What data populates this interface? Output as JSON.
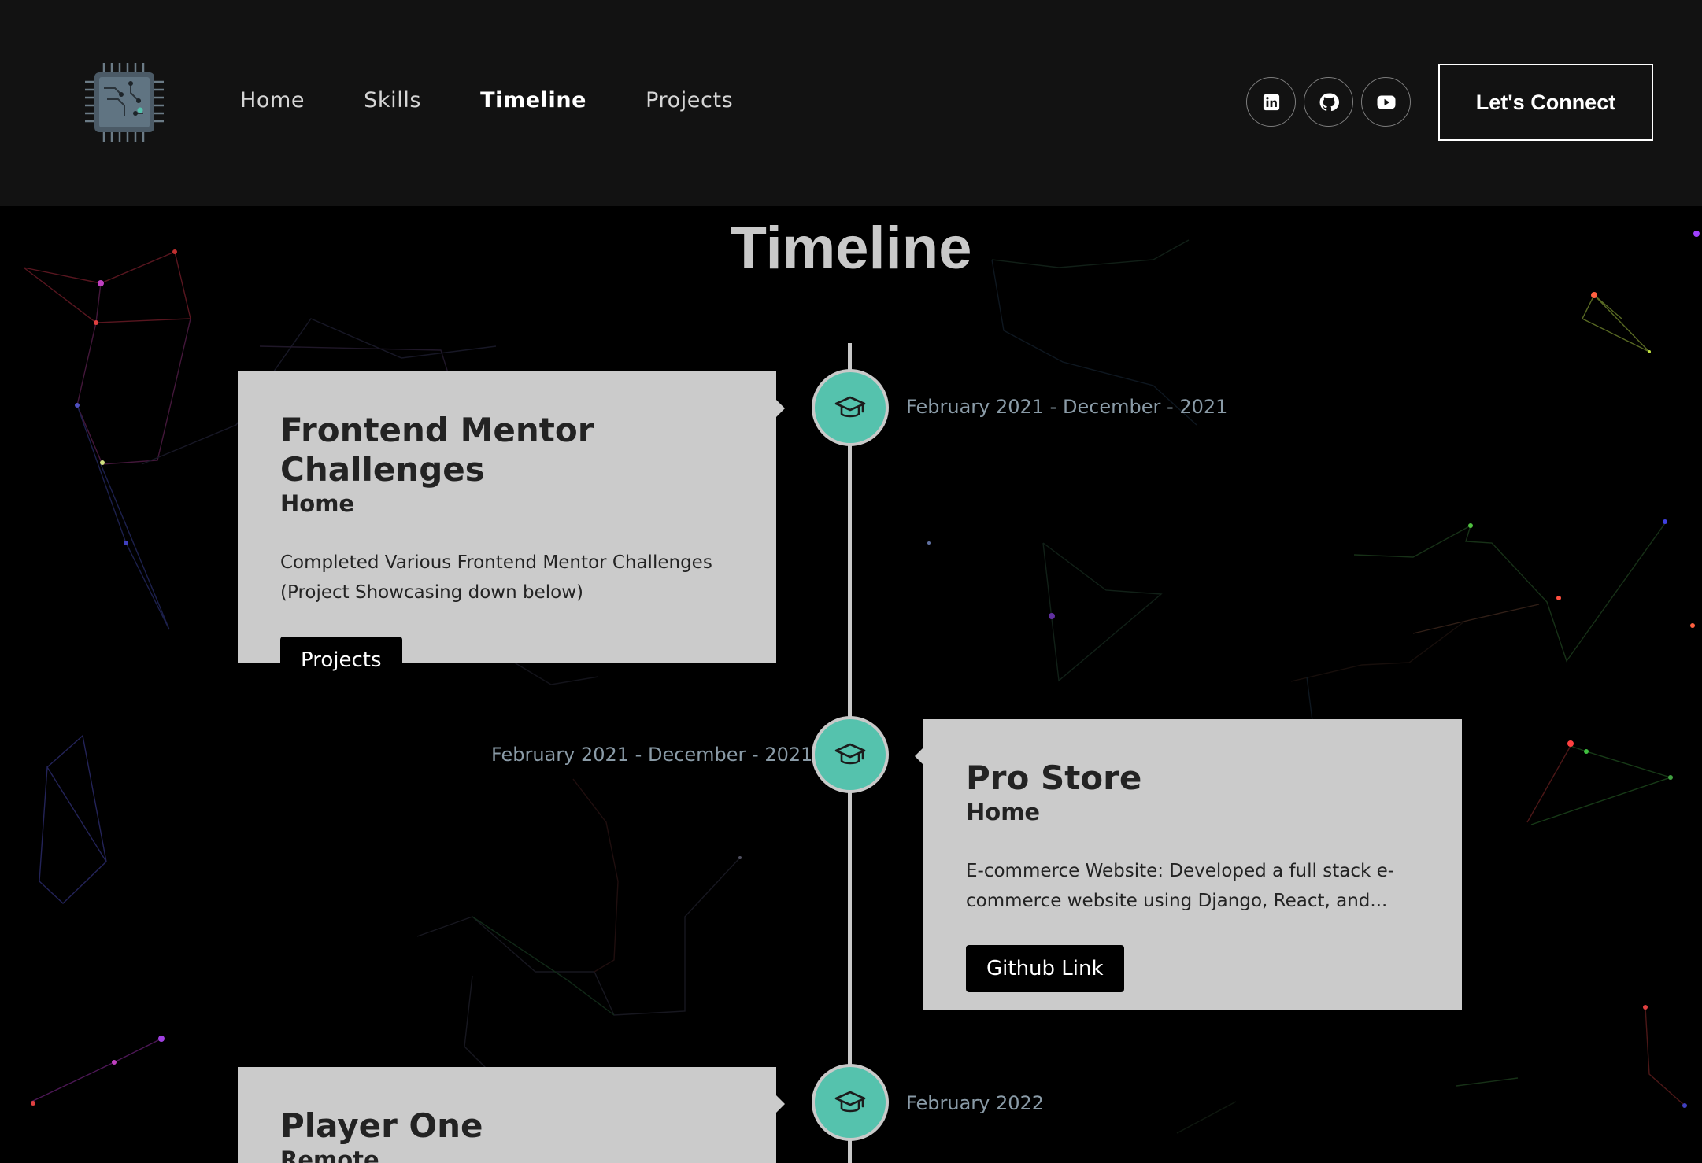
{
  "nav": {
    "links": [
      "Home",
      "Skills",
      "Timeline",
      "Projects"
    ],
    "active": "Timeline",
    "social": [
      "linkedin-icon",
      "github-icon",
      "youtube-icon"
    ],
    "cta_label": "Let's Connect"
  },
  "timeline": {
    "title": "Timeline",
    "entries": [
      {
        "title": "Frontend Mentor Challenges",
        "subtitle": "Home",
        "description": "Completed Various Frontend Mentor Challenges (Project Showcasing down below)",
        "button": "Projects",
        "date": "February 2021 - December - 2021",
        "side": "left"
      },
      {
        "title": "Pro Store",
        "subtitle": "Home",
        "description": "E-commerce Website: Developed a full stack e-commerce website using Django, React, and...",
        "button": "Github Link",
        "date": "February 2021 - December - 2021",
        "side": "right"
      },
      {
        "title": "Player One",
        "subtitle": "Remote",
        "date": "February 2022",
        "side": "left"
      }
    ]
  },
  "colors": {
    "header_bg": "#121212",
    "page_bg": "#000000",
    "card_bg": "#cbcbcb",
    "marker": "#55c2ad",
    "date_text": "#8a9ba7"
  }
}
